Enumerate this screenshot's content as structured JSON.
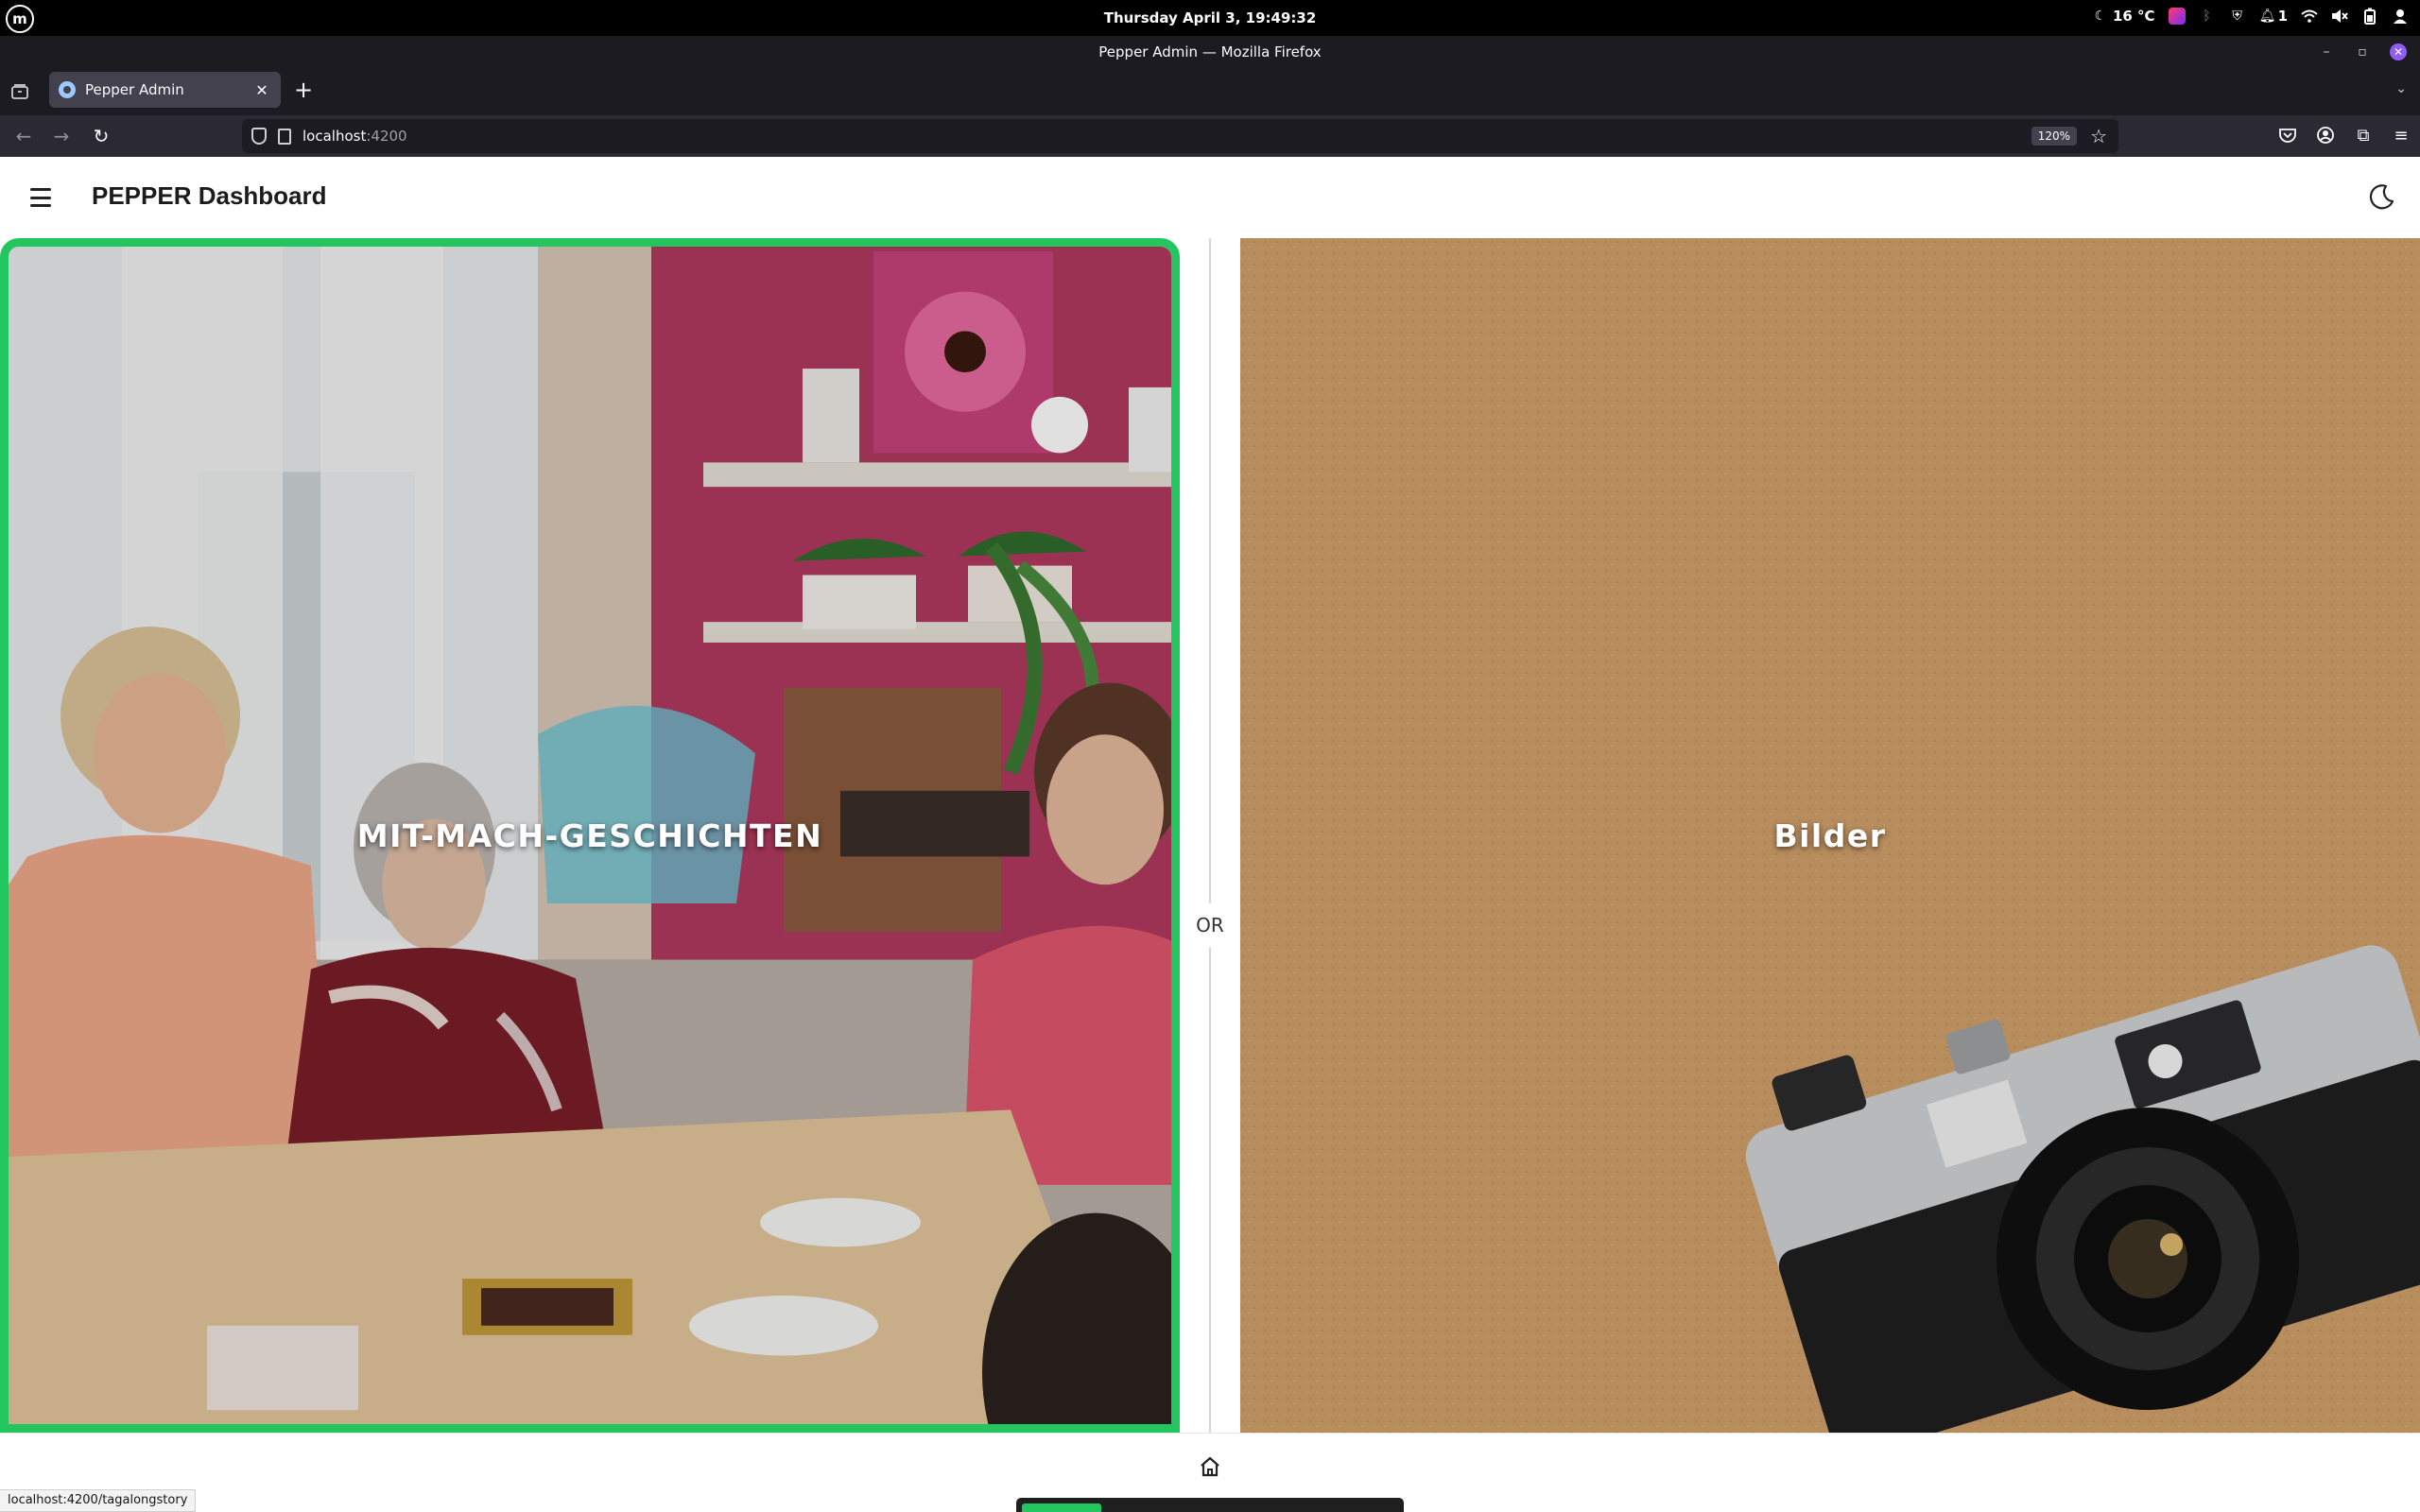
{
  "os": {
    "clock": "Thursday April 3, 19:49:32",
    "weather": "16 °C",
    "notification_count": "1",
    "logo_icon": "linux-mint-logo-icon"
  },
  "window": {
    "title": "Pepper Admin — Mozilla Firefox"
  },
  "browser": {
    "tab_label": "Pepper Admin",
    "url_host": "localhost",
    "url_port": ":4200",
    "zoom": "120%"
  },
  "app": {
    "title": "PEPPER Dashboard",
    "choices": [
      {
        "label": "MIT-MACH-GESCHICHTEN",
        "selected": true
      },
      {
        "label": "Bilder",
        "selected": false
      }
    ],
    "separator": "OR",
    "accent_color": "#22c55e",
    "progress": 0.21
  },
  "status_bar": {
    "link": "localhost:4200/tagalongstory"
  }
}
